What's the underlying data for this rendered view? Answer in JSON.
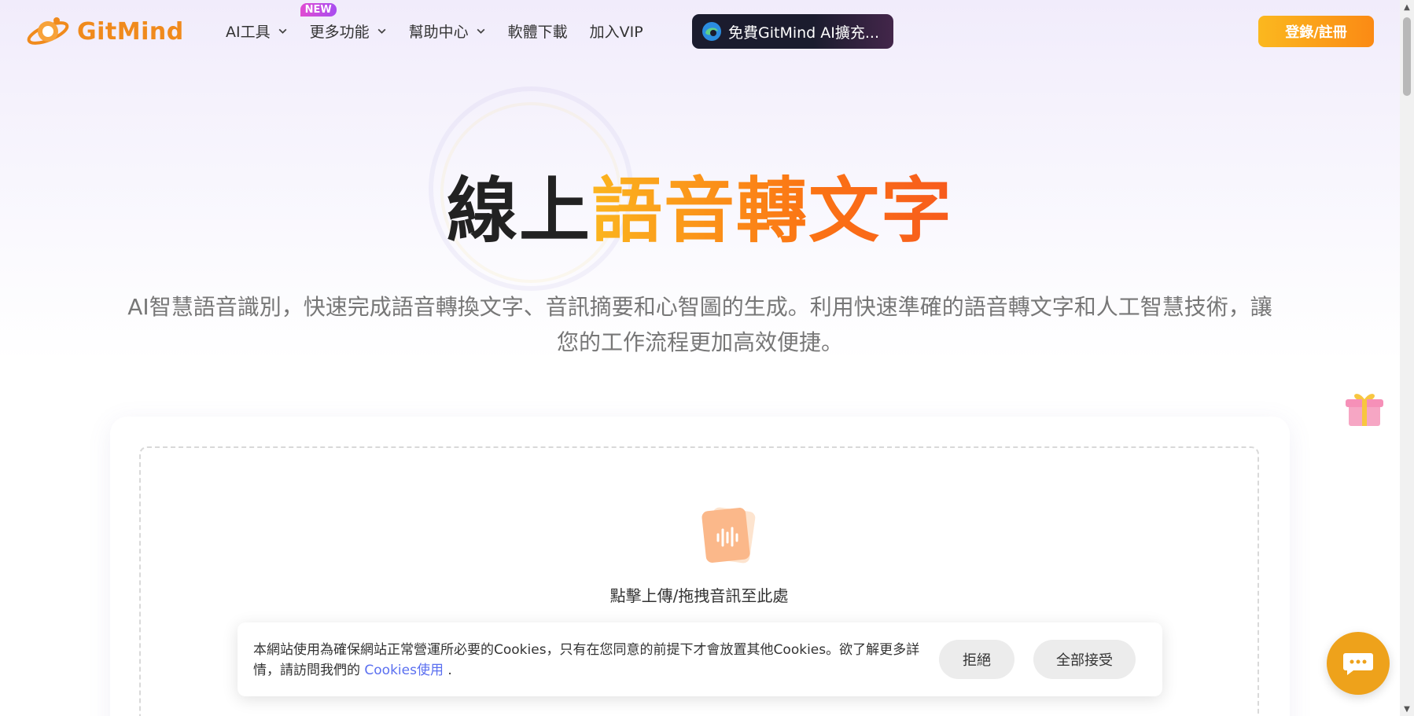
{
  "brand": {
    "name": "GitMind"
  },
  "nav": {
    "items": [
      {
        "label": "AI工具",
        "has_dropdown": true
      },
      {
        "label": "更多功能",
        "has_dropdown": true,
        "badge": "NEW"
      },
      {
        "label": "幫助中心",
        "has_dropdown": true
      },
      {
        "label": "軟體下載",
        "has_dropdown": false
      },
      {
        "label": "加入VIP",
        "has_dropdown": false
      }
    ],
    "extension_button": "免費GitMind AI擴充...",
    "login_button": "登錄/註冊"
  },
  "hero": {
    "title_dark": "線上",
    "title_accent": "語音轉文字",
    "subtitle": "AI智慧語音識別，快速完成語音轉換文字、音訊摘要和心智圖的生成。利用快速準確的語音轉文字和人工智慧技術，讓您的工作流程更加高效便捷。"
  },
  "upload": {
    "prompt": "點擊上傳/拖拽音訊至此處",
    "icon": "audio-file-icon"
  },
  "cookie_banner": {
    "text": "本網站使用為確保網站正常營運所必要的Cookies，只有在您同意的前提下才會放置其他Cookies。欲了解更多詳情，請訪問我們的",
    "link": "Cookies使用",
    "suffix": ".",
    "reject": "拒絕",
    "accept": "全部接受"
  },
  "floating": {
    "gift_icon": "gift-icon",
    "chat_icon": "chat-icon"
  },
  "colors": {
    "brand_orange": "#f08a1c",
    "accent_gradient_start": "#fbb51f",
    "accent_gradient_end": "#f75b1d",
    "chat_button": "#eea21b",
    "link": "#5a6ff0"
  }
}
